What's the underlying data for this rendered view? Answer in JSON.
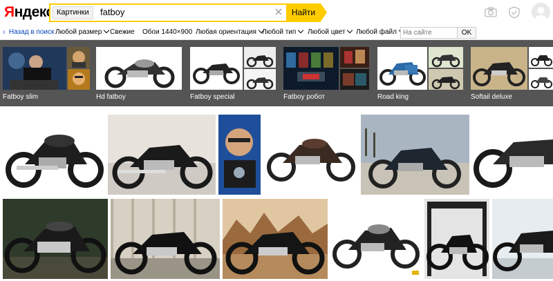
{
  "logo": {
    "text_prefix": "Я",
    "text_rest": "ндекс"
  },
  "search": {
    "service_tab": "Картинки",
    "query": "fatboy",
    "submit_label": "Найти"
  },
  "header_icons": [
    "camera-icon",
    "shield-icon",
    "user-avatar"
  ],
  "filters": {
    "back_label": "Назад в поиск",
    "items": [
      "Любой размер",
      "Свежие",
      "Обои 1440×900",
      "Любая ориентация",
      "Любой тип",
      "Любой цвет",
      "Любой файл"
    ],
    "site_placeholder": "На сайте",
    "ok_label": "OK"
  },
  "related": [
    {
      "label": "Fatboy slim"
    },
    {
      "label": "Hd fatboy"
    },
    {
      "label": "Fatboy special"
    },
    {
      "label": "Fatboy робот"
    },
    {
      "label": "Road king"
    },
    {
      "label": "Softail deluxe"
    }
  ],
  "colors": {
    "accent": "#ffcc00",
    "related_bg": "#555555",
    "link": "#0044bb"
  }
}
